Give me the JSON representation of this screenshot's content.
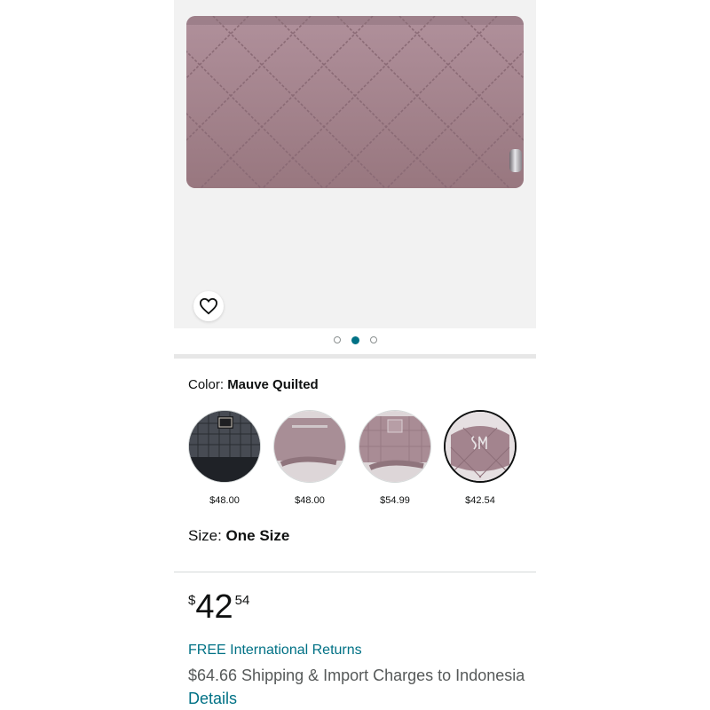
{
  "product": {
    "image_count": 3,
    "active_image_index": 1,
    "wallet_color": "#a58590"
  },
  "favorite": {
    "icon": "heart-outline-icon"
  },
  "color": {
    "label": "Color: ",
    "value": "Mauve Quilted",
    "options": [
      {
        "name": "black",
        "price": "$48.00",
        "selected": false
      },
      {
        "name": "mauve-zip",
        "price": "$48.00",
        "selected": false
      },
      {
        "name": "mauve-logo",
        "price": "$54.99",
        "selected": false
      },
      {
        "name": "mauve-quilted",
        "price": "$42.54",
        "selected": true
      }
    ]
  },
  "size": {
    "label": "Size: ",
    "value": "One Size"
  },
  "price": {
    "symbol": "$",
    "whole": "42",
    "fraction": "54"
  },
  "returns": {
    "text": "FREE International Returns"
  },
  "shipping": {
    "text": "$64.66 Shipping & Import Charges to Indonesia ",
    "link": "Details"
  },
  "colors": {
    "link": "#007185",
    "image_bg": "#f2f2f2",
    "active_dot": "#007185"
  }
}
